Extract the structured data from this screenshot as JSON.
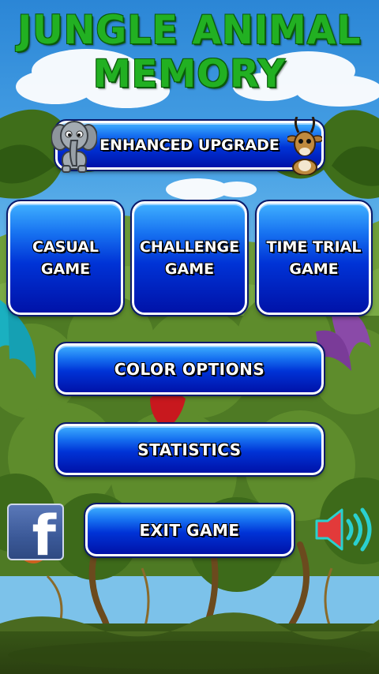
{
  "title": {
    "line1": "JUNGLE ANIMAL",
    "line2": "MEMORY"
  },
  "buttons": {
    "enhanced_upgrade": "ENHANCED UPGRADE",
    "casual_game": "CASUAL\nGAME",
    "challenge_game": "CHALLENGE\nGAME",
    "time_trial_game": "TIME TRIAL\nGAME",
    "color_options": "COLOR OPTIONS",
    "statistics": "STATISTICS",
    "exit_game": "EXIT GAME"
  },
  "icons": {
    "facebook": "facebook-icon",
    "facebook_letter": "f",
    "sound": "speaker-icon",
    "elephant": "elephant-icon",
    "antelope": "antelope-icon"
  },
  "colors": {
    "title_green": "#22b022",
    "button_blue": "#0033d6",
    "facebook_blue": "#3b5998",
    "speaker_red": "#e23a3a",
    "speaker_cyan": "#2ad0d0"
  }
}
